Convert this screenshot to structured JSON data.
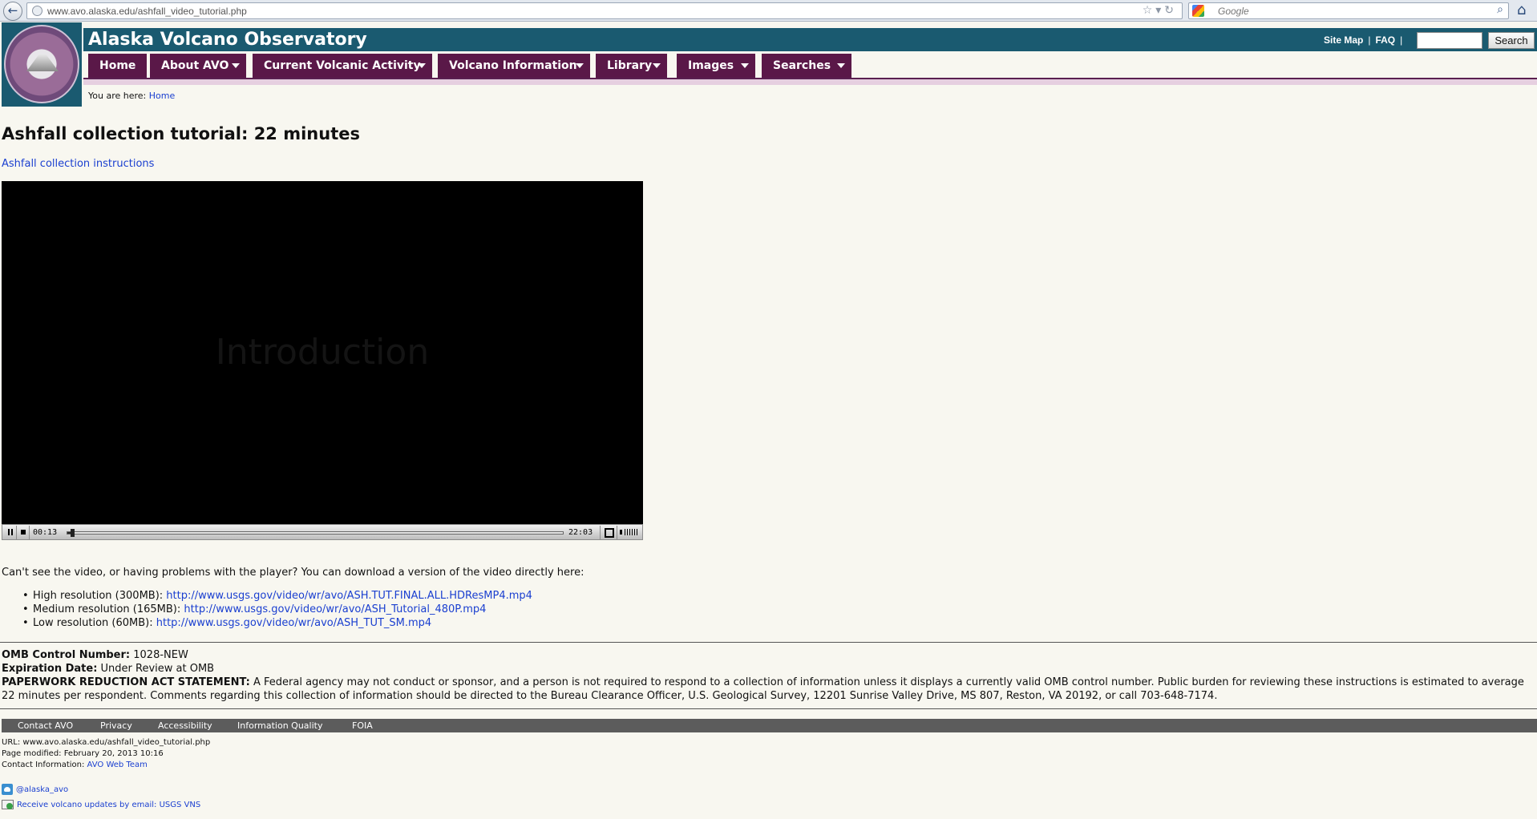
{
  "browser": {
    "url": "www.avo.alaska.edu/ashfall_video_tutorial.php",
    "search_placeholder": "Google"
  },
  "header": {
    "site_title": "Alaska Volcano Observatory",
    "site_map": "Site Map",
    "faq": "FAQ",
    "search_button": "Search"
  },
  "nav": {
    "items": [
      {
        "label": "Home"
      },
      {
        "label": "About AVO"
      },
      {
        "label": "Current Volcanic Activity"
      },
      {
        "label": "Volcano Information"
      },
      {
        "label": "Library"
      },
      {
        "label": "Images"
      },
      {
        "label": "Searches"
      }
    ]
  },
  "breadcrumb": {
    "prefix": "You are here:",
    "home": "Home"
  },
  "main": {
    "title": "Ashfall collection tutorial: 22 minutes",
    "instructions_link": "Ashfall collection instructions",
    "video": {
      "overlay_text": "Introduction",
      "current_time": "00:13",
      "total_time": "22:03",
      "progress": 0.01
    },
    "download_intro": "Can't see the video, or having problems with the player? You can download a version of the video directly here:",
    "downloads": [
      {
        "label": "High resolution (300MB):",
        "url": "http://www.usgs.gov/video/wr/avo/ASH.TUT.FINAL.ALL.HDResMP4.mp4"
      },
      {
        "label": "Medium resolution (165MB):",
        "url": "http://www.usgs.gov/video/wr/avo/ASH_Tutorial_480P.mp4"
      },
      {
        "label": "Low resolution (60MB):",
        "url": "http://www.usgs.gov/video/wr/avo/ASH_TUT_SM.mp4"
      }
    ]
  },
  "omb": {
    "control_label": "OMB Control Number:",
    "control_value": "1028-NEW",
    "expiration_label": "Expiration Date:",
    "expiration_value": "Under Review at OMB",
    "pra_label": "PAPERWORK REDUCTION ACT STATEMENT:",
    "pra_text": "A Federal agency may not conduct or sponsor, and a person is not required to respond to a collection of information unless it displays a currently valid OMB control number. Public burden for reviewing these instructions is estimated to average 22 minutes per respondent. Comments regarding this collection of information should be directed to the Bureau Clearance Officer, U.S. Geological Survey, 12201 Sunrise Valley Drive, MS 807, Reston, VA 20192, or call 703-648-7174."
  },
  "footer": {
    "links": [
      "Contact AVO",
      "Privacy",
      "Accessibility",
      "Information Quality",
      "FOIA"
    ],
    "url_line": "URL: www.avo.alaska.edu/ashfall_video_tutorial.php",
    "modified_line": "Page modified: February 20, 2013 10:16",
    "contact_label": "Contact Information:",
    "contact_link": "AVO Web Team",
    "twitter": "@alaska_avo",
    "email_updates": "Receive volcano updates by email: USGS VNS"
  }
}
